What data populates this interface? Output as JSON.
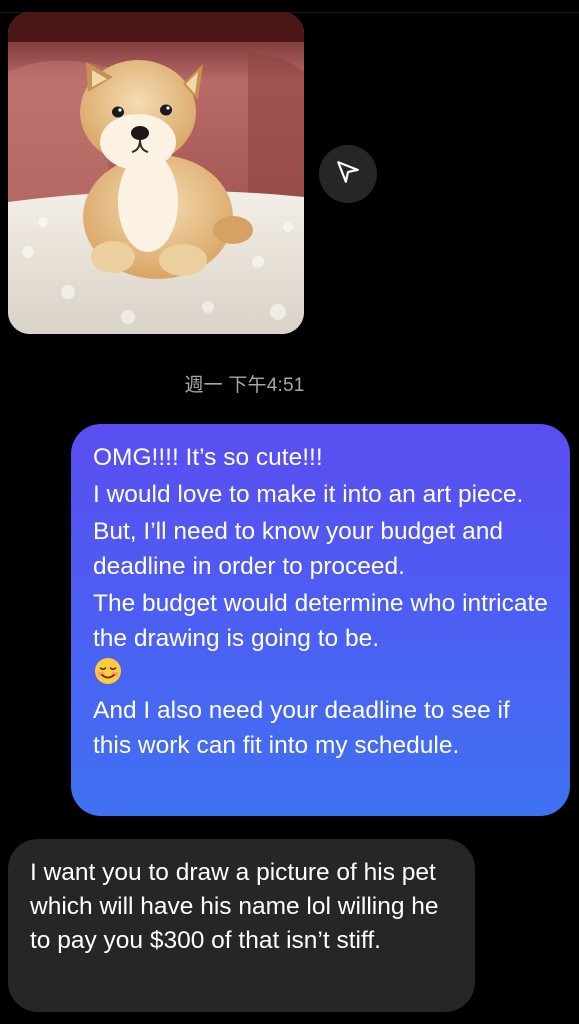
{
  "conversation": {
    "shared_image": {
      "alt": "Shiba Inu puppy photo",
      "share_icon": "send-paper-plane-icon"
    },
    "timestamp": "週一 下午4:51",
    "sent_message": {
      "lines": [
        "OMG!!!! It’s so cute!!!",
        "I would love to make it into an art piece.",
        "But, I’ll need to know your budget and deadline in order to proceed.",
        "The budget would determine who intricate the drawing is going to be.",
        "And I also need your deadline to see if this work can fit into my schedule."
      ],
      "emoji": "smiling-face-with-blush-emoji"
    },
    "received_message": {
      "text": "I want you to draw a picture of his pet which will have his name lol willing he to pay you $300 of that isn’t stiff."
    }
  },
  "colors": {
    "background": "#000000",
    "sent_bubble_top": "#5a4ef0",
    "sent_bubble_bottom": "#3f72f2",
    "received_bubble": "#262626",
    "timestamp": "#a8a8a8",
    "share_button": "#262626"
  }
}
